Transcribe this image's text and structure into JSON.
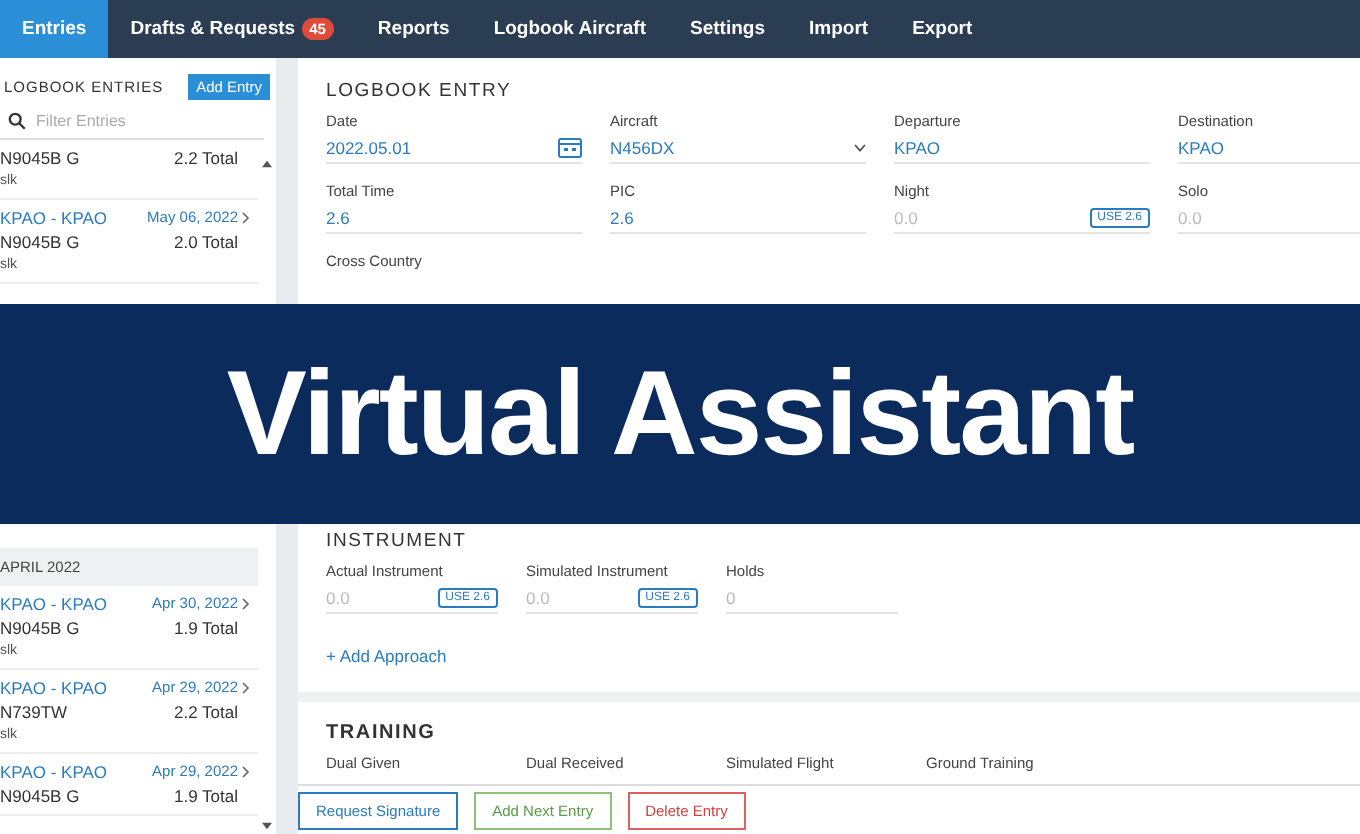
{
  "nav": {
    "tabs": [
      {
        "label": "Entries",
        "selected": true
      },
      {
        "label": "Drafts & Requests",
        "selected": false,
        "badge": "45"
      },
      {
        "label": "Reports",
        "selected": false
      },
      {
        "label": "Logbook Aircraft",
        "selected": false
      },
      {
        "label": "Settings",
        "selected": false
      },
      {
        "label": "Import",
        "selected": false
      },
      {
        "label": "Export",
        "selected": false
      }
    ]
  },
  "sidebar": {
    "title": "LOGBOOK ENTRIES",
    "add_button": "Add Entry",
    "filter": {
      "placeholder": "Filter Entries"
    },
    "groups": [
      {
        "entries": [
          {
            "tail": "N9045B G",
            "total": "2.2 Total",
            "note": "slk"
          },
          {
            "route": "KPAO - KPAO",
            "date": "May 06, 2022",
            "tail": "N9045B G",
            "total": "2.0 Total",
            "note": "slk"
          }
        ]
      },
      {
        "heading": "APRIL 2022",
        "entries": [
          {
            "route": "KPAO - KPAO",
            "date": "Apr 30, 2022",
            "tail": "N9045B G",
            "total": "1.9 Total",
            "note": "slk"
          },
          {
            "route": "KPAO - KPAO",
            "date": "Apr 29, 2022",
            "tail": "N739TW",
            "total": "2.2 Total",
            "note": "slk"
          },
          {
            "route": "KPAO - KPAO",
            "date": "Apr 29, 2022",
            "tail": "N9045B G",
            "total": "1.9 Total"
          }
        ]
      }
    ]
  },
  "entry": {
    "title": "LOGBOOK ENTRY",
    "rows": [
      [
        {
          "label": "Date",
          "value": "2022.05.01",
          "kind": "date"
        },
        {
          "label": "Aircraft",
          "value": "N456DX",
          "kind": "select"
        },
        {
          "label": "Departure",
          "value": "KPAO",
          "kind": "text"
        },
        {
          "label": "Destination",
          "value": "KPAO",
          "kind": "text"
        }
      ],
      [
        {
          "label": "Total Time",
          "value": "2.6",
          "kind": "text"
        },
        {
          "label": "PIC",
          "value": "2.6",
          "kind": "text"
        },
        {
          "label": "Night",
          "placeholder": "0.0",
          "kind": "text",
          "use": "USE 2.6"
        },
        {
          "label": "Solo",
          "placeholder": "0.0",
          "kind": "text"
        }
      ],
      [
        {
          "label": "Cross Country"
        }
      ]
    ]
  },
  "instrument": {
    "title": "INSTRUMENT",
    "fields": [
      {
        "label": "Actual Instrument",
        "placeholder": "0.0",
        "use": "USE 2.6"
      },
      {
        "label": "Simulated Instrument",
        "placeholder": "0.0",
        "use": "USE 2.6"
      },
      {
        "label": "Holds",
        "placeholder": "0"
      }
    ],
    "add_link": "+ Add Approach"
  },
  "training": {
    "title": "TRAINING",
    "labels": [
      "Dual Given",
      "Dual Received",
      "Simulated Flight",
      "Ground Training"
    ]
  },
  "footer": {
    "buttons": [
      {
        "label": "Request Signature",
        "kind": "primary"
      },
      {
        "label": "Add Next Entry",
        "kind": "success"
      },
      {
        "label": "Delete Entry",
        "kind": "danger"
      }
    ]
  },
  "overlay": {
    "title": "Virtual Assistant"
  }
}
